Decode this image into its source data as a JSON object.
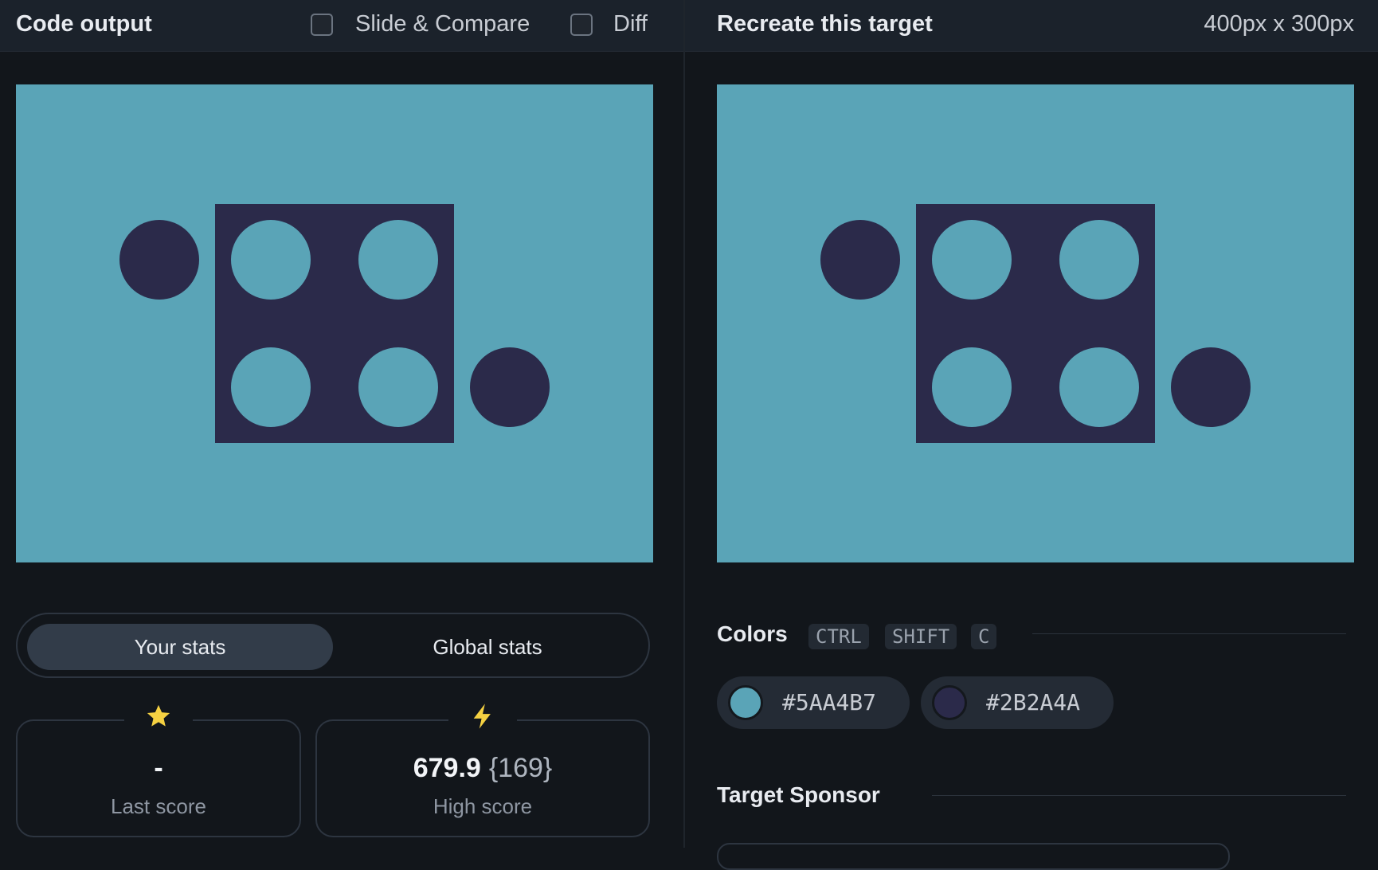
{
  "colors": {
    "background": "#5AA4B7",
    "foreground": "#2B2A4A"
  },
  "left_panel": {
    "title": "Code output",
    "slide_compare_label": "Slide & Compare",
    "diff_label": "Diff",
    "tabs": {
      "your_stats": "Your stats",
      "global_stats": "Global stats"
    },
    "stats": {
      "last": {
        "icon": "star-icon",
        "value": "-",
        "label": "Last score"
      },
      "high": {
        "icon": "lightning-icon",
        "value": "679.9",
        "sub": "{169}",
        "label": "High score"
      }
    }
  },
  "right_panel": {
    "title": "Recreate this target",
    "dimensions": "400px x 300px",
    "colors_title": "Colors",
    "shortcut_keys": [
      "CTRL",
      "SHIFT",
      "C"
    ],
    "swatches": [
      {
        "hex": "#5AA4B7",
        "label": "#5AA4B7"
      },
      {
        "hex": "#2B2A4A",
        "label": "#2B2A4A"
      }
    ],
    "sponsor_title": "Target Sponsor"
  }
}
